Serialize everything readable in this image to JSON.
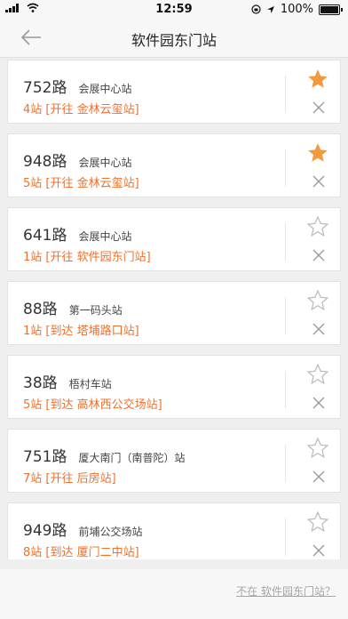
{
  "status_bar": {
    "time": "12:59",
    "battery": "100%"
  },
  "nav": {
    "title": "软件园东门站"
  },
  "routes": [
    {
      "name": "752路",
      "direction": "会展中心站",
      "status": "4站 [开往 金林云玺站]",
      "favorite": true
    },
    {
      "name": "948路",
      "direction": "会展中心站",
      "status": "5站 [开往 金林云玺站]",
      "favorite": true
    },
    {
      "name": "641路",
      "direction": "会展中心站",
      "status": "1站 [开往 软件园东门站]",
      "favorite": false
    },
    {
      "name": "88路",
      "direction": "第一码头站",
      "status": "1站 [到达 塔埔路口站]",
      "favorite": false
    },
    {
      "name": "38路",
      "direction": "梧村车站",
      "status": "5站 [到达 高林西公交场站]",
      "favorite": false
    },
    {
      "name": "751路",
      "direction": "厦大南门（南普陀）站",
      "status": "7站 [开往 后房站]",
      "favorite": false
    },
    {
      "name": "949路",
      "direction": "前埔公交场站",
      "status": "8站 [到达 厦门二中站]",
      "favorite": false
    }
  ],
  "footer": {
    "link": "不在 软件园东门站？"
  },
  "colors": {
    "accent": "#f0702c",
    "star_filled": "#f39a3c",
    "star_outline": "#bdbdbd"
  }
}
